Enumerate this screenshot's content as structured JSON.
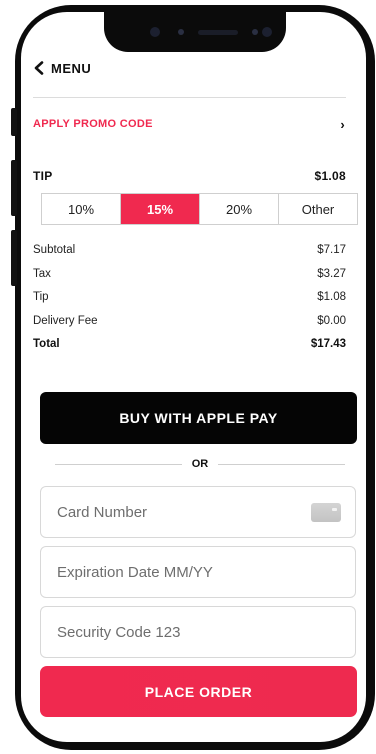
{
  "header": {
    "menu_label": "MENU"
  },
  "promo": {
    "label": "APPLY PROMO CODE"
  },
  "tip": {
    "label": "TIP",
    "amount": "$1.08",
    "options": [
      "10%",
      "15%",
      "20%",
      "Other"
    ],
    "selected": "15%"
  },
  "summary": {
    "rows": [
      {
        "label": "Subtotal",
        "value": "$7.17"
      },
      {
        "label": "Tax",
        "value": "$3.27"
      },
      {
        "label": "Tip",
        "value": "$1.08"
      },
      {
        "label": "Delivery Fee",
        "value": "$0.00"
      },
      {
        "label": "Total",
        "value": "$17.43"
      }
    ]
  },
  "apple_pay": {
    "label": "BUY WITH APPLE PAY"
  },
  "divider": {
    "label": "OR"
  },
  "form": {
    "card_number": {
      "value": "",
      "placeholder": "Card Number"
    },
    "expiration": {
      "value": "",
      "placeholder": "Expiration Date MM/YY"
    },
    "security_code": {
      "value": "",
      "placeholder": "Security Code 123"
    }
  },
  "place_order": {
    "label": "PLACE ORDER"
  },
  "colors": {
    "accent": "#f0294f",
    "dark": "#050505"
  },
  "icons": {
    "back": "chevron-left-icon",
    "promo_arrow": "chevron-right-icon",
    "card": "credit-card-icon"
  }
}
